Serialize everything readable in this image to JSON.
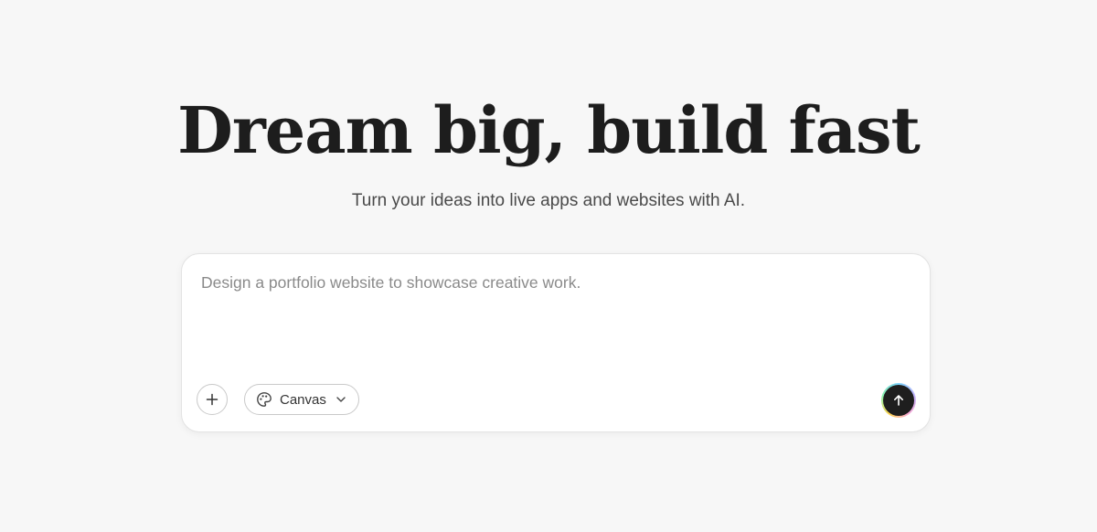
{
  "hero": {
    "title": "Dream big, build fast",
    "subtitle": "Turn your ideas into live apps and websites with AI."
  },
  "prompt": {
    "placeholder": "Design a portfolio website to showcase creative work.",
    "value": "",
    "add_icon": "plus-icon",
    "mode": {
      "label": "Canvas",
      "icon": "palette-icon",
      "chevron_icon": "chevron-down-icon"
    },
    "send_icon": "arrow-up-icon"
  },
  "colors": {
    "background": "#f7f7f7",
    "card": "#ffffff",
    "send_button": "#1e1e1e"
  }
}
